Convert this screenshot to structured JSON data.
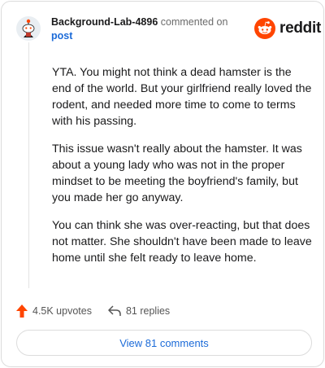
{
  "comment": {
    "username": "Background-Lab-4896",
    "action": "commented on",
    "target": "post",
    "paragraphs": [
      "YTA. You might not think a dead hamster is the end of the world. But your girlfriend really loved the rodent, and needed more time to come to terms with his passing.",
      "This issue wasn't really about the hamster. It was about a young lady who was not in the proper mindset to be meeting the boyfriend's family, but you made her go anyway.",
      "You can think she was over-reacting, but that does not matter. She shouldn't have been made to leave home until she felt ready to leave home."
    ],
    "upvotes_label": "4.5K upvotes",
    "replies_label": "81 replies"
  },
  "brand": {
    "logo_text": "reddit",
    "logo_icon": "reddit-snoo-icon",
    "accent": "#ff4500"
  },
  "footer": {
    "upvote_icon": "upvote-arrow-icon",
    "reply_icon": "reply-arrow-icon",
    "view_comments_label": "View 81 comments"
  },
  "colors": {
    "link": "#1c6bd8",
    "upvote": "#ff4500",
    "text": "#1a1a1b",
    "muted": "#6b6b6b"
  }
}
